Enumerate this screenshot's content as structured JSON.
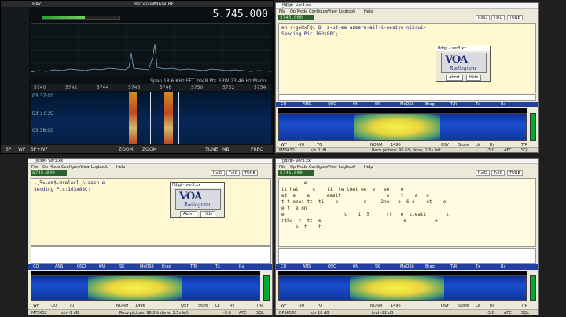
{
  "sdr": {
    "header_labels": [
      "BAYL",
      "Receiver",
      "MAIN RF"
    ],
    "frequency": "5.745.000",
    "info_line": "Span 18.6 KHz   FFT 2048 Pts   RBW 23.46 Hz   Marks 0.2 KHz",
    "ruler_ticks": [
      "5740",
      "5742",
      "5744",
      "5746",
      "5748",
      "5750",
      "5752",
      "5754"
    ],
    "waterfall_times": [
      "03:37:00",
      "03:37:30",
      "03:38:00"
    ],
    "bottom_buttons": [
      "SP",
      "WF",
      "SP+WF",
      "ZOOM",
      "ZOOM",
      "TUNE",
      "NB",
      "FREQ"
    ]
  },
  "win_common": {
    "title": "fldigi - ver3.xx",
    "menu": [
      "File",
      "Op Mode",
      "Configure",
      "View",
      "Logbook",
      "Help"
    ],
    "rxid": "RxID",
    "txid": "TxID",
    "tune": "TUNE",
    "macros": [
      "CQ",
      "ANS",
      "QSO",
      "KN",
      "SK",
      "MeQSh",
      "Brag",
      "T/R",
      "Tx",
      "Rx"
    ],
    "ctrl": [
      "WF",
      "-20",
      "70",
      "NORM",
      "1496",
      "QSY",
      "Store",
      "Lk",
      "Rv",
      "T/R"
    ],
    "status_bar": [
      "AFC",
      "SQL"
    ]
  },
  "win_top_right": {
    "freq": "5745.000",
    "rx_lines": [
      "eh r-geUxFQi B  z-ut-ea azeere-aiF-i-eesiye niSrui-",
      "Sending Pic:163x88C;"
    ],
    "status_mode": "MFSK32",
    "status_sn": "s/n  0 dB",
    "status_msg": "Recv picture: 96.6% done, 1.5s left",
    "status_val": "-3.0"
  },
  "win_bottom_left": {
    "freq": "5745.000",
    "rx_lines": [
      "-,5>-em$-mrelecl n-aesn e",
      "",
      "Sending Pic:163x88C;"
    ],
    "status_mode": "MFSK32",
    "status_sn": "s/n  -1 dB",
    "status_msg": "Recv picture: 96.6% done, 1.5s left",
    "status_val": "-3.0"
  },
  "win_bottom_right": {
    "freq": "5745.000",
    "rx_lines": [
      "        e",
      "tt hat     c    ti  tw toet ee  e   ee    e",
      "et  e    e      easit                o    t    a   o",
      "t t eoei tt  ti    e         e     2ne   e  S o    et    e",
      "e t  e on",
      "e                     t    i  5      rt   e  tteatt       t",
      "rtho  t  tt  e                             e          e",
      "     e  t    t"
    ],
    "status_mode": "BPSK500",
    "status_sn": "s/n 18 dB",
    "status_msg": "imd -22 dB",
    "status_val": "-3.0"
  },
  "voa": {
    "title": "fldigi - ver3.xx",
    "logo_big": "VOA",
    "logo_small": "Radiogram",
    "abort": "Abort",
    "hide": "Hide"
  }
}
